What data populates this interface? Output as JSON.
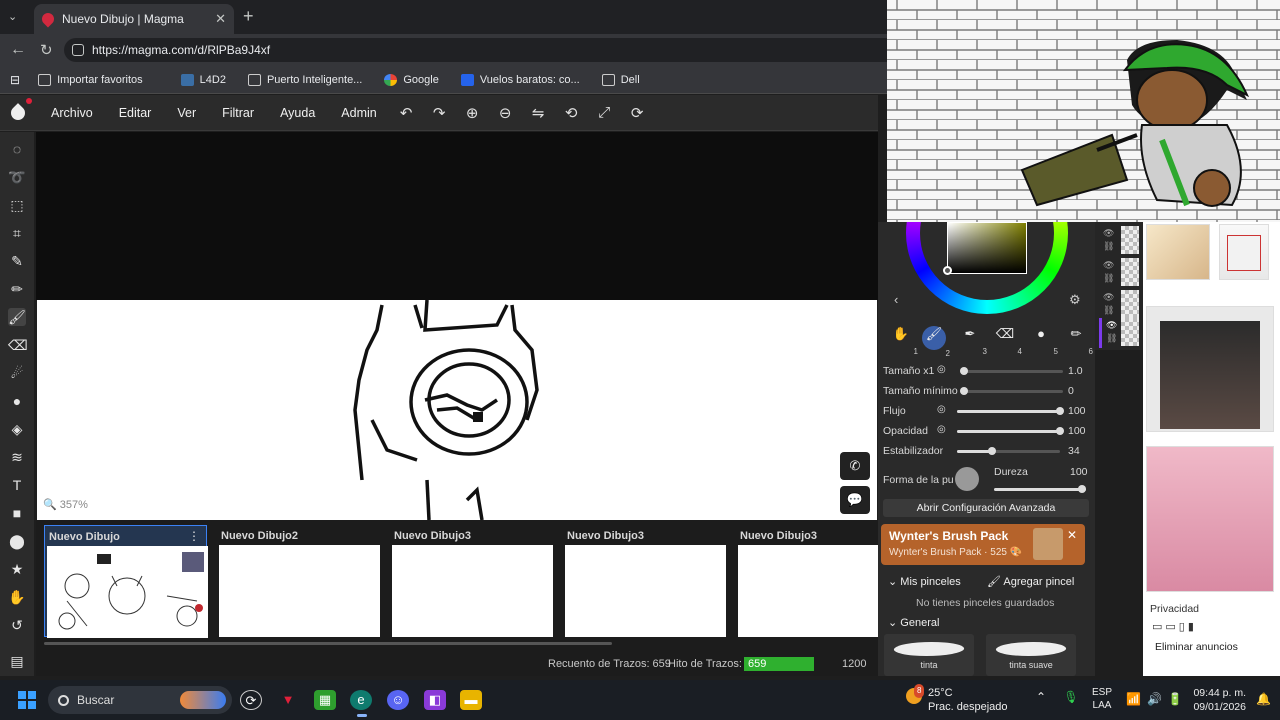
{
  "browser": {
    "tab_title": "Nuevo Dibujo | Magma",
    "url": "https://magma.com/d/RlPBa9J4xf",
    "bookmarks": [
      {
        "label": "Importar favoritos"
      },
      {
        "label": "L4D2"
      },
      {
        "label": "Puerto Inteligente..."
      },
      {
        "label": "Google"
      },
      {
        "label": "Vuelos baratos: co..."
      },
      {
        "label": "Dell"
      }
    ]
  },
  "app": {
    "menu": [
      "Archivo",
      "Editar",
      "Ver",
      "Filtrar",
      "Ayuda",
      "Admin"
    ],
    "zoom": "357%"
  },
  "drawings": [
    {
      "label": "Nuevo Dibujo",
      "selected": true
    },
    {
      "label": "Nuevo Dibujo2"
    },
    {
      "label": "Nuevo Dibujo3"
    },
    {
      "label": "Nuevo Dibujo3"
    },
    {
      "label": "Nuevo Dibujo3"
    }
  ],
  "status": {
    "stroke_count": "Recuento de Trazos: 659",
    "stroke_hit_label": "Hito de Trazos:",
    "stroke_hit_value": "659",
    "stroke_hit_max": "1200",
    "stroke_hit_fraction": 0.549
  },
  "brush_panel": {
    "slots": [
      "1",
      "2",
      "3",
      "4",
      "5",
      "6"
    ],
    "sliders": [
      {
        "label": "Tamaño x1",
        "value": "1.0",
        "fraction": 0.0
      },
      {
        "label": "Tamaño mínimo",
        "value": "0",
        "fraction": 0.0
      },
      {
        "label": "Flujo",
        "value": "100",
        "fraction": 1.0
      },
      {
        "label": "Opacidad",
        "value": "100",
        "fraction": 1.0
      },
      {
        "label": "Estabilizador",
        "value": "34",
        "fraction": 0.34
      }
    ],
    "shape_label": "Forma de la pu",
    "hardness_label": "Dureza",
    "hardness_value": "100",
    "advanced_button": "Abrir Configuración Avanzada",
    "promo_title": "Wynter's Brush Pack",
    "promo_sub": "Wynter's Brush Pack · 525 🎨",
    "my_brushes": "Mis pinceles",
    "add_brush": "Agregar pincel",
    "no_brushes": "No tienes pinceles guardados",
    "general": "General",
    "presets": [
      "tinta",
      "tinta suave"
    ]
  },
  "ads": {
    "privacy": "Privacidad",
    "remove_ads": "Eliminar anuncios"
  },
  "taskbar": {
    "search": "Buscar",
    "temp": "25°C",
    "weather": "Prac. despejado",
    "lang1": "ESP",
    "lang2": "LAA",
    "time": "09:44 p. m.",
    "date": "09/01/2026",
    "weather_badge": "8"
  },
  "colors": {
    "accent": "#3b82f6",
    "progress": "#2fb02f",
    "promo": "#b5632b"
  }
}
